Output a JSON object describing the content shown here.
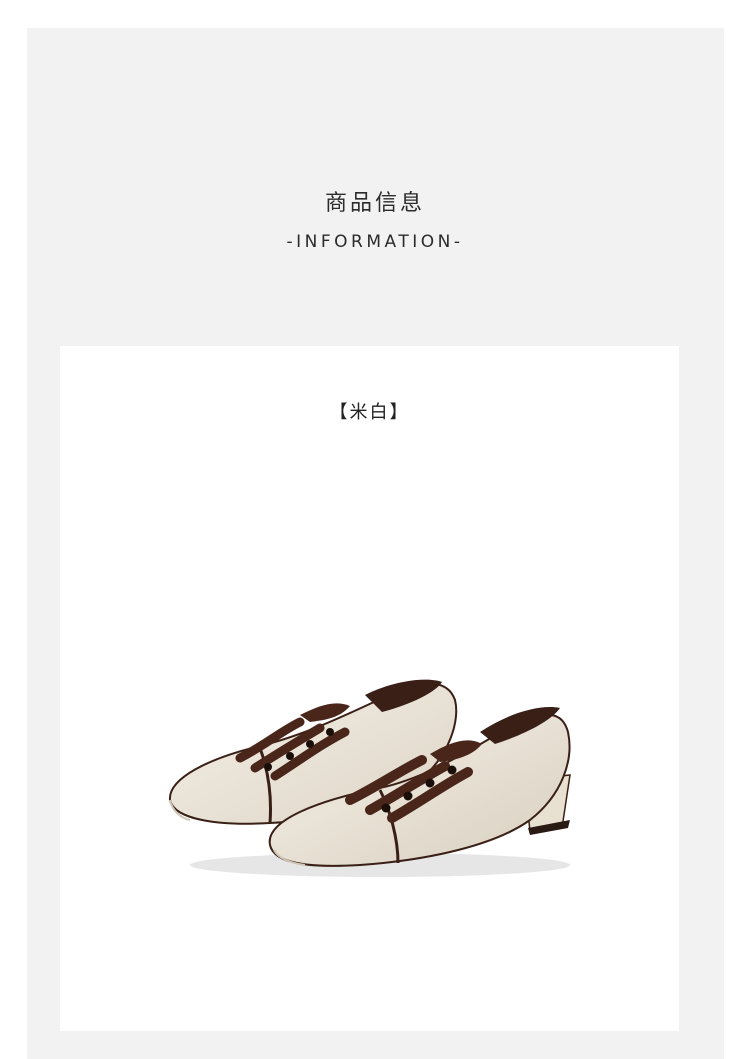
{
  "header": {
    "title_cn": "商品信息",
    "title_en": "-INFORMATION-"
  },
  "product": {
    "color_label": "【米白】",
    "image_subject": "shoe-pair-image",
    "colors": {
      "leather": "#ece6da",
      "trim": "#3a1f16",
      "ribbon": "#4a261a",
      "panel_background": "#f2f2f2"
    }
  }
}
